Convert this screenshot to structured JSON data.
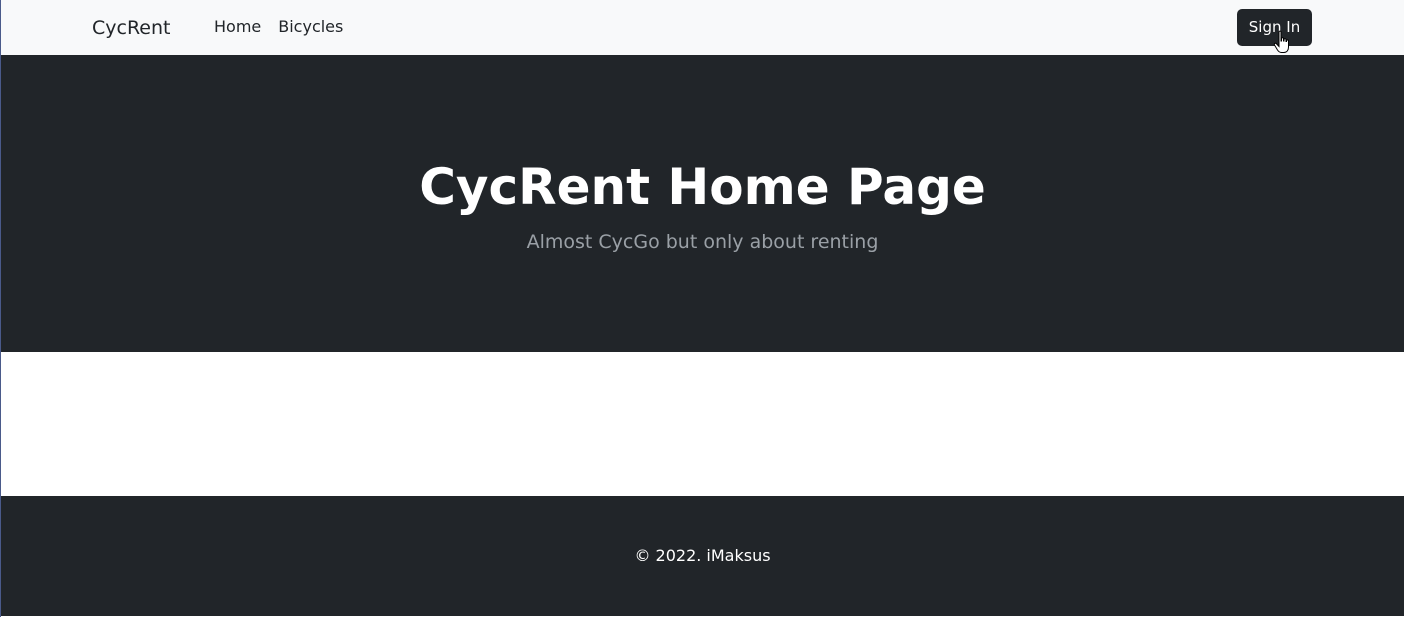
{
  "navbar": {
    "brand": "CycRent",
    "links": [
      {
        "label": "Home"
      },
      {
        "label": "Bicycles"
      }
    ],
    "signin_label": "Sign In"
  },
  "hero": {
    "title": "CycRent Home Page",
    "subtitle": "Almost CycGo but only about renting"
  },
  "footer": {
    "text": "© 2022. iMaksus"
  },
  "colors": {
    "dark": "#212529",
    "navbar_bg": "#f8f9fa",
    "subtitle": "#9aa0a6"
  },
  "icons": {
    "cursor": "hand-pointer-cursor-icon"
  }
}
